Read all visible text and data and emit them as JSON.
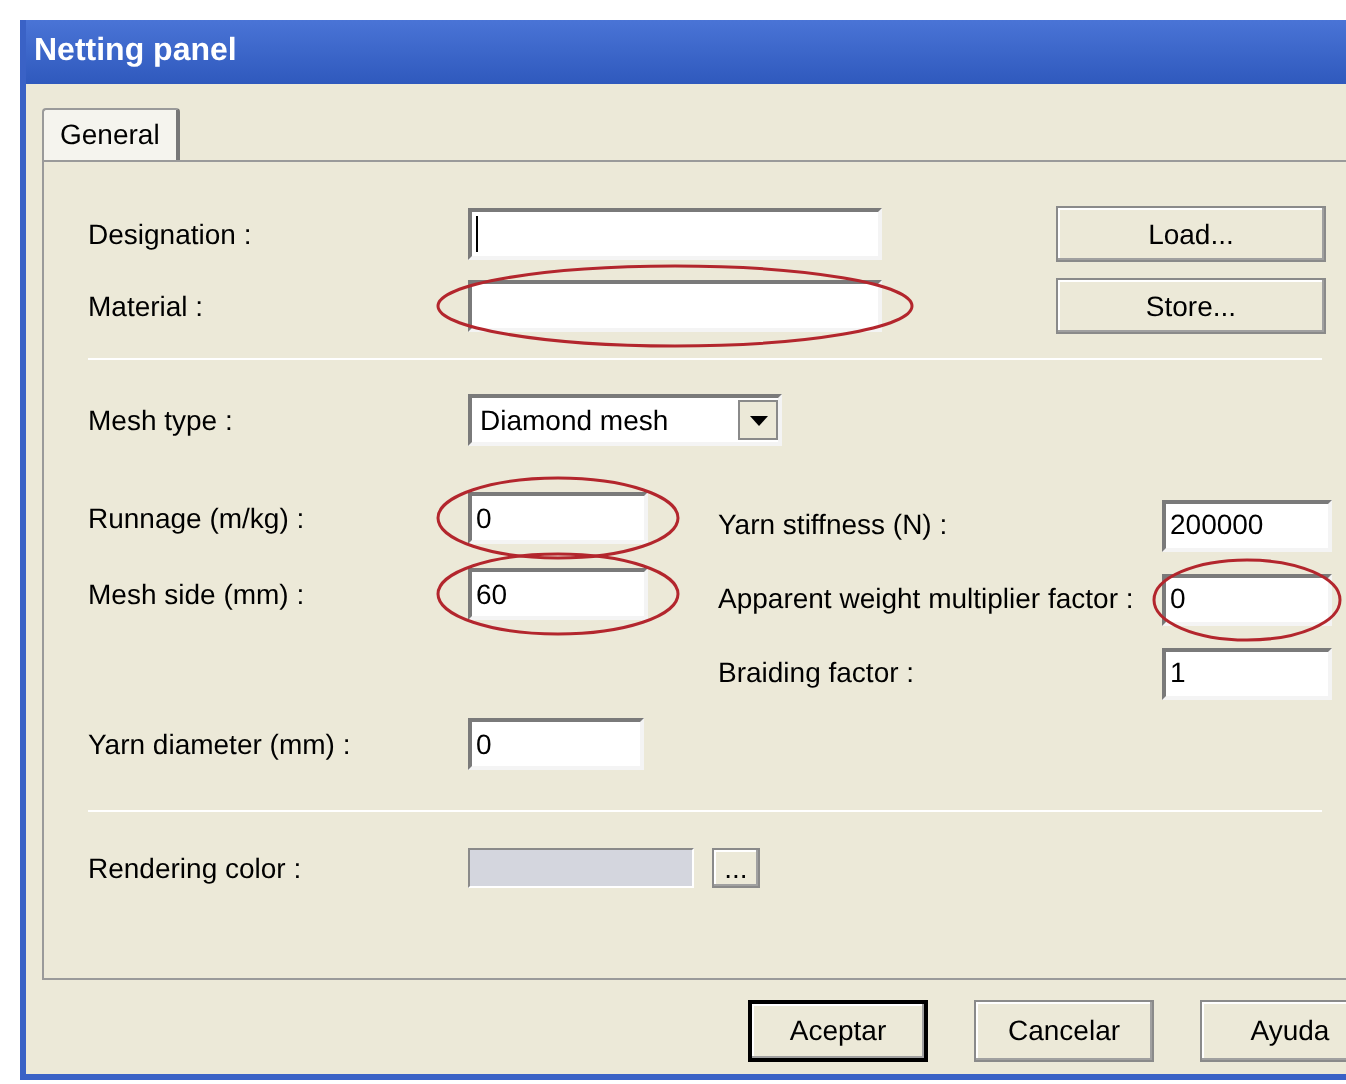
{
  "window": {
    "title": "Netting panel"
  },
  "tabs": [
    {
      "label": "General",
      "selected": true
    }
  ],
  "designation": {
    "label": "Designation :",
    "focused": true,
    "circled": false
  },
  "material": {
    "label": "Material :",
    "focused": false,
    "circled": true
  },
  "side_buttons": [
    "Load...",
    "Store..."
  ],
  "mesh_type": {
    "label": "Mesh type :",
    "value": "Diamond mesh"
  },
  "left_fields": [
    {
      "label": "Runnage (m/kg) :",
      "value": "0",
      "circled": true
    },
    {
      "label": "Mesh side (mm) :",
      "value": "60",
      "circled": true
    }
  ],
  "right_fields": [
    {
      "label": "Yarn stiffness (N) :",
      "value": "200000",
      "circled": false
    },
    {
      "label": "Apparent weight multiplier factor :",
      "value": "0",
      "circled": true
    },
    {
      "label": "Braiding factor :",
      "value": "1",
      "circled": false
    }
  ],
  "yarn_diameter": {
    "label": "Yarn diameter (mm) :",
    "value": "0",
    "circled": false
  },
  "rendering_color": {
    "label": "Rendering color :",
    "color": "#d4d6de",
    "button": "..."
  },
  "buttons": [
    {
      "label": "Aceptar",
      "default": true
    },
    {
      "label": "Cancelar",
      "default": false
    },
    {
      "label": "Ayuda",
      "default": false
    }
  ]
}
